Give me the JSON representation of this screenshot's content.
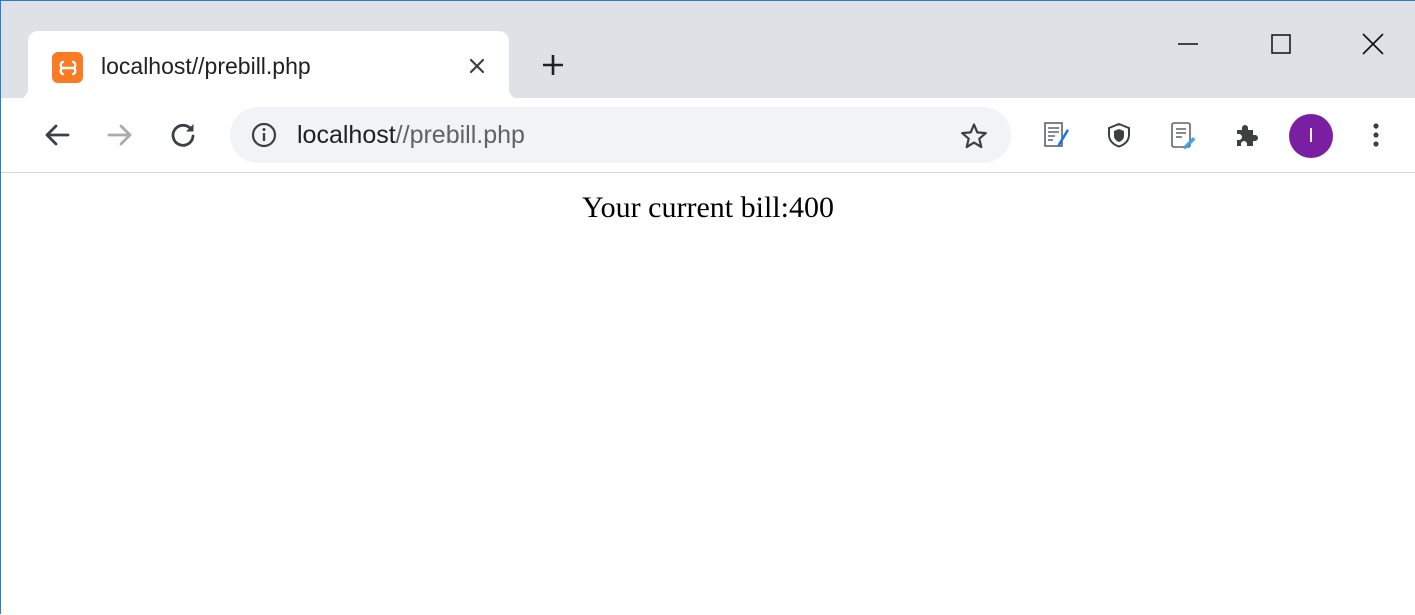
{
  "tab": {
    "title": "localhost//prebill.php"
  },
  "address_bar": {
    "host": "localhost",
    "path": "//prebill.php"
  },
  "profile": {
    "initial": "I",
    "color": "#7b1fa2"
  },
  "page": {
    "bill_text": "Your current bill:400"
  },
  "colors": {
    "tabstrip": "#dee1e6",
    "favicon": "#fb7a24",
    "omnibox": "#f1f3f4"
  },
  "icons": {
    "favicon": "xampp-icon",
    "tab_close": "close-icon",
    "new_tab": "plus-icon",
    "minimize": "minimize-icon",
    "maximize": "maximize-icon",
    "close_window": "close-icon",
    "back": "arrow-left-icon",
    "forward": "arrow-right-icon",
    "reload": "reload-icon",
    "site_info": "info-icon",
    "bookmark": "star-icon",
    "extensions": [
      "document-edit-icon",
      "shield-icon",
      "note-pen-icon",
      "puzzle-icon"
    ],
    "menu": "kebab-menu-icon"
  }
}
